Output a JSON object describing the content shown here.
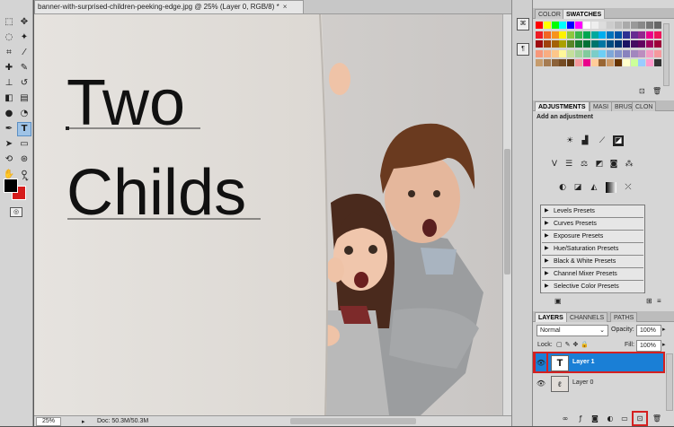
{
  "document": {
    "tab_title": "banner-with-surprised-children-peeking-edge.jpg @ 25% (Layer 0, RGB/8) *",
    "close": "×",
    "text_line1": "Two",
    "text_line2": "Childs",
    "zoom": "25%",
    "doc_info": "Doc: 50.3M/50.3M"
  },
  "swatches_panel": {
    "tabs": [
      "COLOR",
      "SWATCHES"
    ],
    "active_tab": "SWATCHES"
  },
  "adjustments_panel": {
    "tabs": [
      "ADJUSTMENTS",
      "MASI",
      "BRUS",
      "CLON"
    ],
    "title": "Add an adjustment",
    "presets": [
      "Levels Presets",
      "Curves Presets",
      "Exposure Presets",
      "Hue/Saturation Presets",
      "Black & White Presets",
      "Channel Mixer Presets",
      "Selective Color Presets"
    ]
  },
  "layers_panel": {
    "tabs": [
      "LAYERS",
      "CHANNELS",
      "PATHS"
    ],
    "blend_mode": "Normal",
    "opacity_label": "Opacity:",
    "opacity_value": "100%",
    "lock_label": "Lock:",
    "fill_label": "Fill:",
    "fill_value": "100%",
    "layers": [
      {
        "name": "Layer 1",
        "thumb": "T",
        "selected": true
      },
      {
        "name": "Layer 0",
        "thumb": "",
        "selected": false
      }
    ]
  },
  "colors": {
    "accent_selection": "#1a7fd6",
    "highlight_box": "#d42020",
    "foreground": "#000000",
    "background_color": "#d61c1c"
  }
}
